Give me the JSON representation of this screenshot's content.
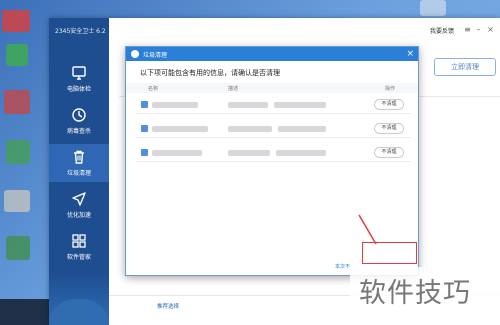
{
  "app": {
    "title": "2345安全卫士 6.2",
    "feedback": "我要反馈",
    "clean_now": "立即清理",
    "recommend": "推荐选择"
  },
  "sidebar": {
    "items": [
      {
        "label": "电脑体检",
        "icon": "monitor-icon"
      },
      {
        "label": "病毒查杀",
        "icon": "virus-scan-icon"
      },
      {
        "label": "垃圾清理",
        "icon": "trash-icon",
        "active": true
      },
      {
        "label": "优化加速",
        "icon": "rocket-icon"
      },
      {
        "label": "软件管家",
        "icon": "apps-icon"
      }
    ]
  },
  "dialog": {
    "title": "垃圾清理",
    "message": "以下项可能包含有用的信息，请确认是否清理",
    "columns": {
      "name": "名称",
      "desc": "描述",
      "action": "操作"
    },
    "rows": [
      {
        "action": "不清理"
      },
      {
        "action": "不清理"
      },
      {
        "action": "不清理"
      }
    ],
    "footer": "本次不"
  },
  "watermark": "软件技巧",
  "colors": {
    "sidebar": "#1f4e90",
    "dialog_header": "#2b7fd6",
    "highlight": "#e83a3a"
  }
}
